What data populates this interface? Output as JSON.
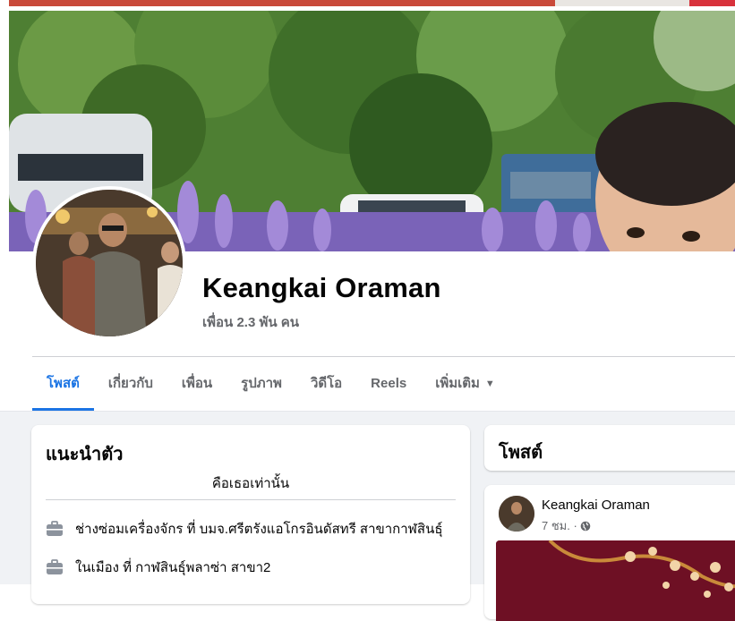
{
  "profile": {
    "name": "Keangkai Oraman",
    "friends": "เพื่อน 2.3 พัน คน"
  },
  "tabs": [
    {
      "label": "โพสต์",
      "active": true
    },
    {
      "label": "เกี่ยวกับ",
      "active": false
    },
    {
      "label": "เพื่อน",
      "active": false
    },
    {
      "label": "รูปภาพ",
      "active": false
    },
    {
      "label": "วิดีโอ",
      "active": false
    },
    {
      "label": "Reels",
      "active": false
    },
    {
      "label": "เพิ่มเติม",
      "active": false
    }
  ],
  "intro": {
    "title": "แนะนำตัว",
    "bio": "คือเธอเท่านั้น",
    "items": [
      {
        "icon": "briefcase-icon",
        "text": "ช่างซ่อมเครื่องจักร ที่ บมจ.ศรีตรังแอโกรอินดัสทรี สาขากาฬสินธุ์"
      },
      {
        "icon": "briefcase-icon",
        "text": "ในเมือง ที่ กาฬสินธุ์พลาซ่า สาขา2"
      }
    ]
  },
  "posts_section": {
    "title": "โพสต์"
  },
  "post": {
    "author": "Keangkai Oraman",
    "time": "7 ชม. ·",
    "privacy_icon": "globe-icon"
  },
  "colors": {
    "accent": "#1b74e4",
    "secondary_text": "#65676b",
    "page_bg": "#f0f2f5"
  }
}
